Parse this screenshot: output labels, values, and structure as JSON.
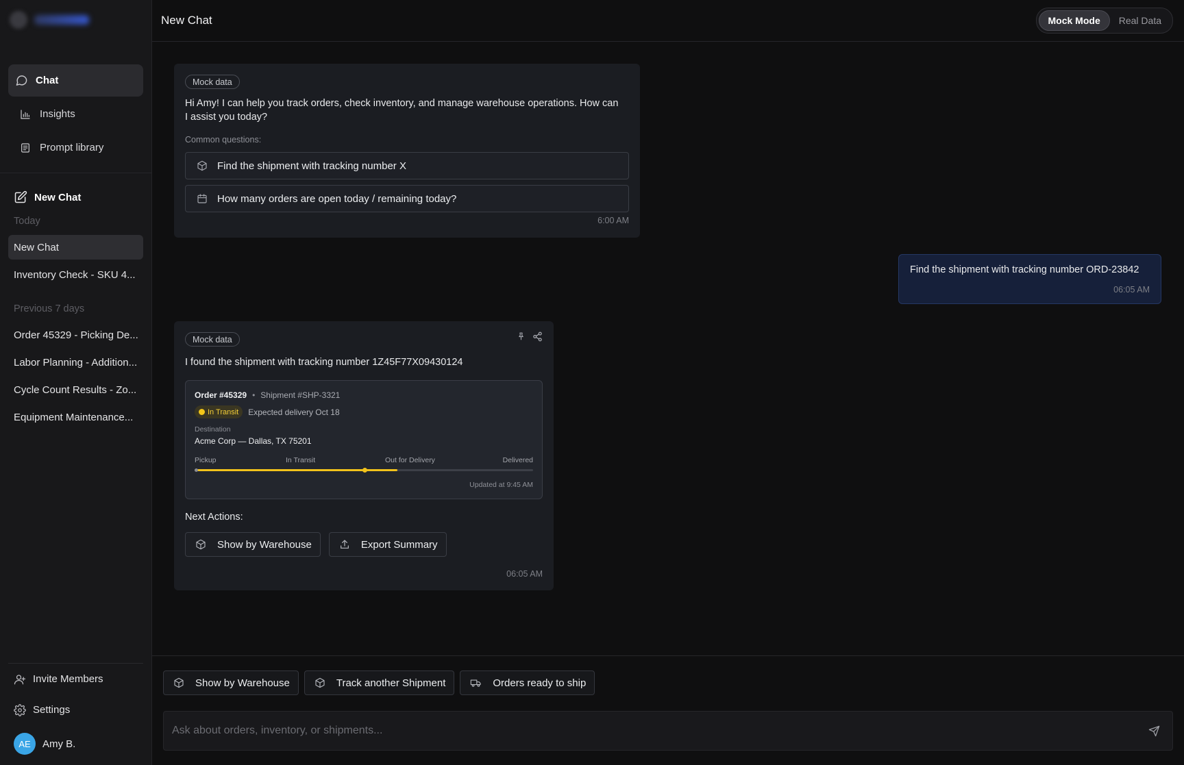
{
  "sidebar": {
    "nav": [
      {
        "label": "Chat",
        "icon": "chat-bubble-icon"
      },
      {
        "label": "Insights",
        "icon": "bar-chart-icon"
      },
      {
        "label": "Prompt library",
        "icon": "document-list-icon"
      }
    ],
    "new_chat_label": "New Chat",
    "today_label": "Today",
    "today_items": [
      "New Chat",
      "Inventory Check - SKU 4..."
    ],
    "prev_label": "Previous 7 days",
    "prev_items": [
      "Order 45329 - Picking De...",
      "Labor Planning - Addition...",
      "Cycle Count Results - Zo...",
      "Equipment Maintenance..."
    ],
    "invite_label": "Invite Members",
    "settings_label": "Settings",
    "user": {
      "initials": "AE",
      "name": "Amy B.",
      "avatar_color": "#3aa5e6"
    }
  },
  "topbar": {
    "title": "New Chat",
    "modes": [
      "Mock Mode",
      "Real Data"
    ],
    "active_mode": "Mock Mode"
  },
  "messages": {
    "assistant_1": {
      "tag": "Mock data",
      "text": "Hi Amy! I can help you track orders, check inventory, and manage warehouse operations. How can I assist you today?",
      "common_label": "Common questions:",
      "questions": [
        {
          "label": "Find the shipment with tracking number X",
          "icon": "package-icon"
        },
        {
          "label": "How many orders are open today / remaining today?",
          "icon": "calendar-icon"
        }
      ],
      "time": "6:00 AM"
    },
    "user_1": {
      "text": "Find the shipment with tracking number ORD-23842",
      "time": "06:05 AM"
    },
    "assistant_2": {
      "tag": "Mock data",
      "text": "I found the shipment with tracking number 1Z45F77X09430124",
      "shipment": {
        "order": "Order #45329",
        "shipment_id": "Shipment #SHP-3321",
        "status": "In Transit",
        "status_color": "#f2c619",
        "expected": "Expected delivery Oct 18",
        "destination_label": "Destination",
        "destination": "Acme Corp — Dallas, TX 75201",
        "stages": [
          "Pickup",
          "In Transit",
          "Out for Delivery",
          "Delivered"
        ],
        "progress": 0.6,
        "updated": "Updated at 9:45 AM"
      },
      "next_label": "Next Actions:",
      "actions": [
        {
          "label": "Show by Warehouse",
          "icon": "package-icon"
        },
        {
          "label": "Export Summary",
          "icon": "upload-icon"
        }
      ],
      "time": "06:05 AM"
    }
  },
  "composer": {
    "chips": [
      {
        "label": "Show by Warehouse",
        "icon": "package-icon"
      },
      {
        "label": "Track another Shipment",
        "icon": "package-icon"
      },
      {
        "label": "Orders ready to ship",
        "icon": "truck-icon"
      }
    ],
    "placeholder": "Ask about orders, inventory, or shipments..."
  }
}
